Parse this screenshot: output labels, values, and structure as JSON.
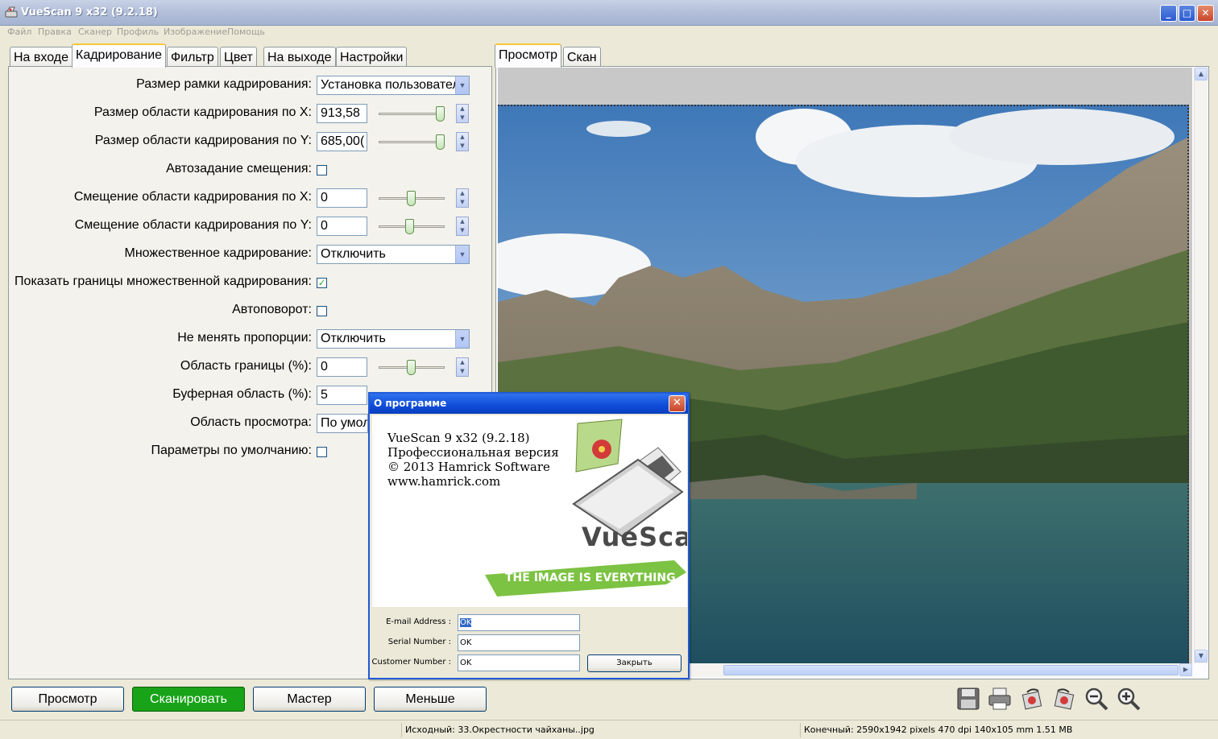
{
  "window": {
    "title": "VueScan 9 x32 (9.2.18)",
    "buttons": {
      "minimize": "_",
      "maximize": "□",
      "close": "✕"
    }
  },
  "menu": [
    "Файл",
    "Правка",
    "Сканер",
    "Профиль",
    "Изображение",
    "Помощь"
  ],
  "left_tabs": [
    "На входе",
    "Кадрирование",
    "Фильтр",
    "Цвет",
    "На выходе",
    "Настройки"
  ],
  "active_left_tab": "Кадрирование",
  "right_tabs": [
    "Просмотр",
    "Скан"
  ],
  "active_right_tab": "Просмотр",
  "settings": {
    "crop_size": {
      "label": "Размер рамки кадрирования:",
      "value": "Установка пользовател"
    },
    "x_size": {
      "label": "Размер области кадрирования по X:",
      "value": "913,58",
      "slider": 0.95
    },
    "y_size": {
      "label": "Размер области кадрирования по Y:",
      "value": "685,00(",
      "slider": 0.95
    },
    "auto_offset": {
      "label": "Автозадание смещения:",
      "checked": false
    },
    "x_offset": {
      "label": "Смещение области кадрирования по X:",
      "value": "0",
      "slider": 0.5
    },
    "y_offset": {
      "label": "Смещение области кадрирования по Y:",
      "value": "0",
      "slider": 0.5
    },
    "multi_crop": {
      "label": "Множественное кадрирование:",
      "value": "Отключить"
    },
    "show_multi_bounds": {
      "label": "Показать границы множественной кадрирования:",
      "checked": true
    },
    "auto_rotate": {
      "label": "Автоповорот:",
      "checked": false
    },
    "keep_ratio": {
      "label": "Не менять пропорции:",
      "value": "Отключить"
    },
    "border": {
      "label": "Область границы (%):",
      "value": "0",
      "slider": 0.5
    },
    "buffer": {
      "label": "Буферная область (%):",
      "value": "5"
    },
    "preview_area": {
      "label": "Область просмотра:",
      "value": "По умол"
    },
    "defaults": {
      "label": "Параметры по умолчанию:",
      "checked": false
    }
  },
  "bottom_buttons": {
    "preview": "Просмотр",
    "scan": "Сканировать",
    "wizard": "Мастер",
    "less": "Меньше"
  },
  "toolbar_icons": [
    "save-icon",
    "print-icon",
    "rotate-left-icon",
    "rotate-right-icon",
    "zoom-out-icon",
    "zoom-in-icon"
  ],
  "status": {
    "source": "Исходный: 33.Окрестности чайханы..jpg",
    "result": "Конечный: 2590x1942 pixels 470 dpi 140x105 mm 1.51 MB"
  },
  "about": {
    "title": "О программе",
    "close": "✕",
    "line1": "VueScan 9 x32 (9.2.18)",
    "line2": "Профессиональная версия",
    "line3": "© 2013 Hamrick Software",
    "line4": "www.hamrick.com",
    "logo_text": "VueScan",
    "tagline": "THE IMAGE IS EVERYTHING",
    "email_label": "E-mail Address :",
    "email_value": "OK",
    "serial_label": "Serial Number :",
    "serial_value": "OK",
    "customer_label": "Customer Number :",
    "customer_value": "OK",
    "close_button": "Закрыть"
  },
  "colors": {
    "scan_button": "#18a318",
    "dialog_title": "#0f4cd8",
    "selection": "#316ac5"
  }
}
